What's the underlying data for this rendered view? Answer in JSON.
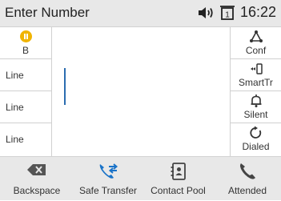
{
  "header": {
    "title": "Enter Number",
    "time": "16:22",
    "line_badge": "1"
  },
  "left_keys": [
    {
      "label": "B",
      "icon": "pause-icon"
    },
    {
      "label": "Line"
    },
    {
      "label": "Line"
    },
    {
      "label": "Line"
    }
  ],
  "right_keys": [
    {
      "label": "Conf",
      "icon": "conference-icon"
    },
    {
      "label": "SmartTr",
      "icon": "smart-transfer-icon"
    },
    {
      "label": "Silent",
      "icon": "bell-icon"
    },
    {
      "label": "Dialed",
      "icon": "redial-icon"
    }
  ],
  "softkeys": [
    {
      "label": "Backspace",
      "icon": "backspace-icon"
    },
    {
      "label": "Safe Transfer",
      "icon": "transfer-icon"
    },
    {
      "label": "Contact Pool",
      "icon": "contacts-icon"
    },
    {
      "label": "Attended",
      "icon": "phone-icon"
    }
  ],
  "colors": {
    "accent": "#1a73c8",
    "hold": "#f0b400",
    "header_bg": "#e8e8e8"
  }
}
